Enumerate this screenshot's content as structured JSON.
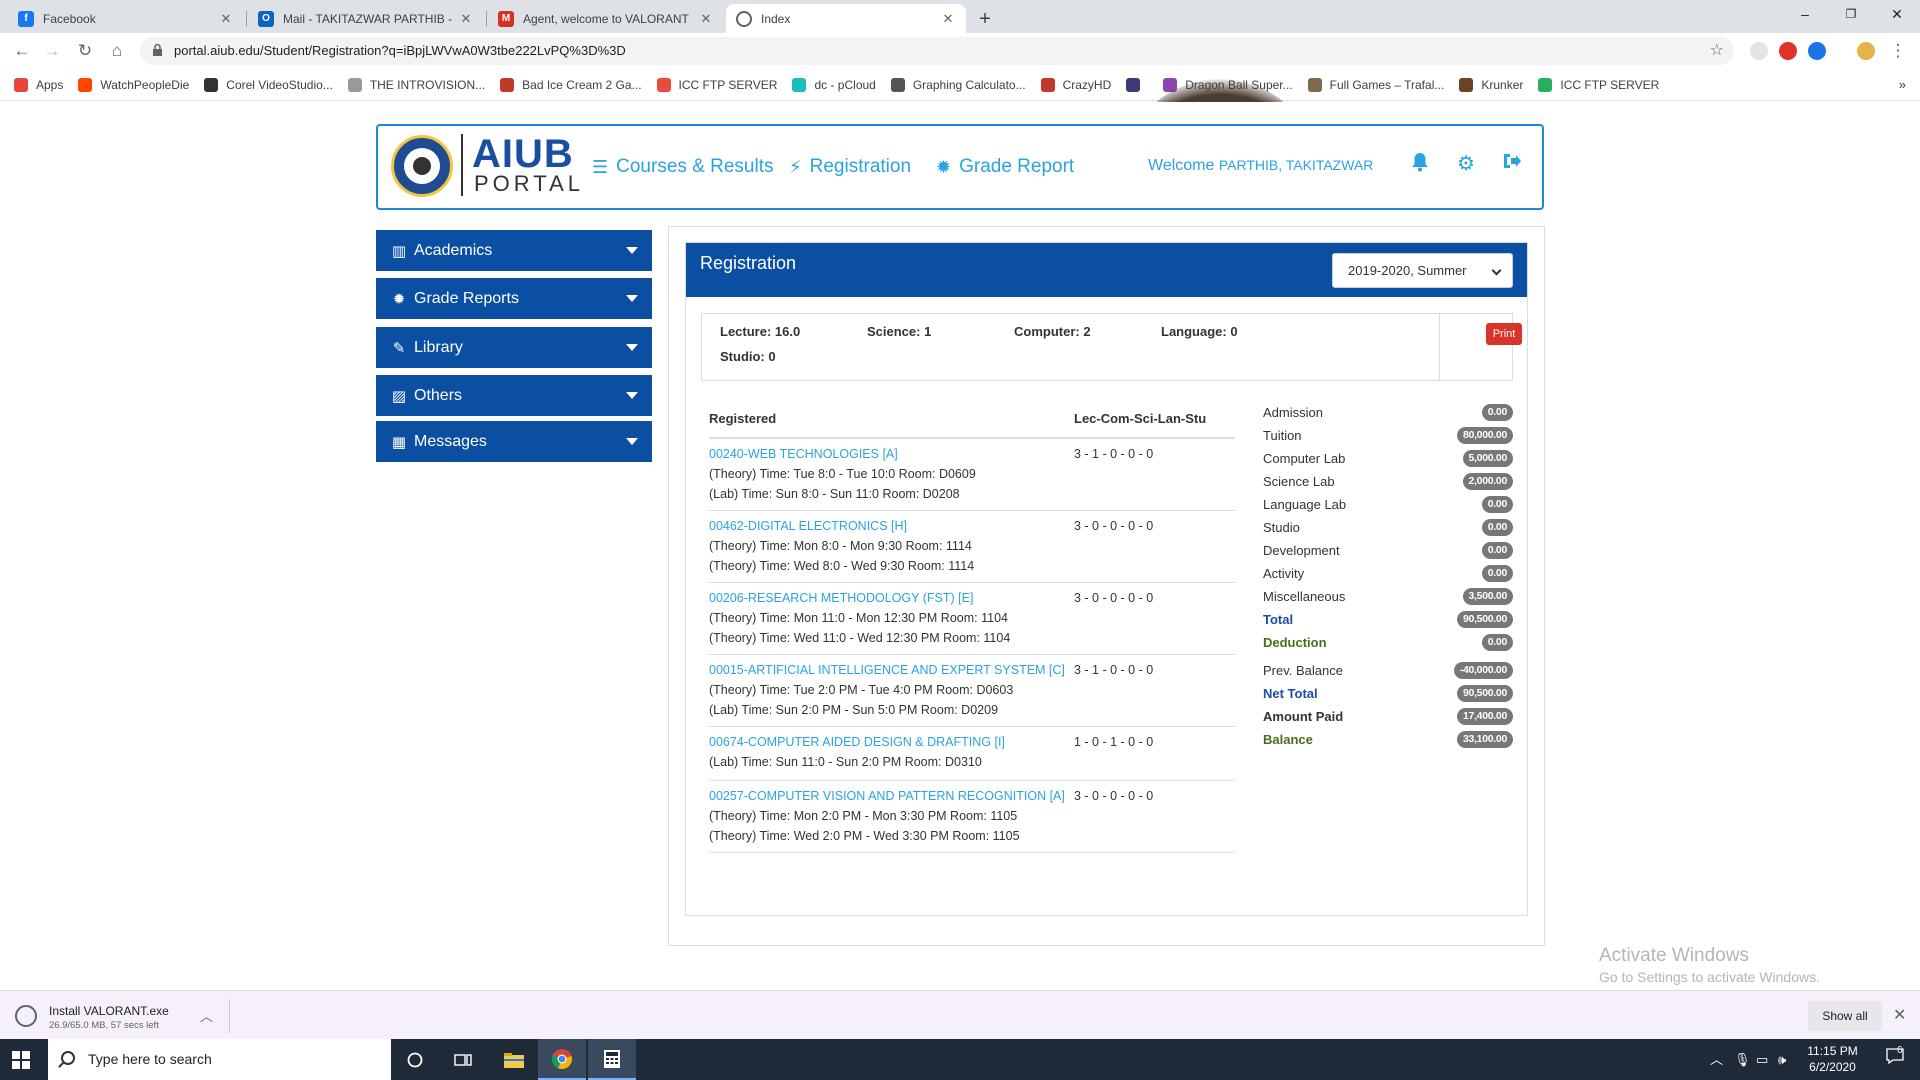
{
  "browser": {
    "tabs": [
      {
        "title": "Facebook",
        "icon": "facebook-icon",
        "color": "#1877f2",
        "glyph": "f"
      },
      {
        "title": "Mail - TAKITAZWAR PARTHIB - O",
        "icon": "outlook-icon",
        "color": "#0a64c4",
        "glyph": "O"
      },
      {
        "title": "Agent, welcome to VALORANT - ",
        "icon": "gmail-icon",
        "color": "#d93025",
        "glyph": "M"
      },
      {
        "title": "Index",
        "icon": "globe-icon",
        "color": "#5f6368",
        "glyph": ""
      }
    ],
    "url": "portal.aiub.edu/Student/Registration?q=iBpjLWVwA0W3tbe222LvPQ%3D%3D",
    "window_controls": {
      "minimize": "–",
      "maximize": "❐",
      "close": "✕"
    },
    "bookmarks": [
      {
        "label": "Apps",
        "color": "#e8453c"
      },
      {
        "label": "WatchPeopleDie",
        "color": "#ff4500"
      },
      {
        "label": "Corel VideoStudio...",
        "color": "#333333"
      },
      {
        "label": "THE INTROVISION...",
        "color": "#999999"
      },
      {
        "label": "Bad Ice Cream 2 Ga...",
        "color": "#c0392b"
      },
      {
        "label": "ICC FTP SERVER",
        "color": "#e74c3c"
      },
      {
        "label": "dc - pCloud",
        "color": "#17bebb"
      },
      {
        "label": "Graphing Calculato...",
        "color": "#555555"
      },
      {
        "label": "CrazyHD",
        "color": "#c0392b"
      },
      {
        "label": "",
        "color": "#3b3b7a"
      },
      {
        "label": "Dragon Ball Super...",
        "color": "#8e44ad"
      },
      {
        "label": "Full Games – Trafal...",
        "color": "#7f6a4e"
      },
      {
        "label": "Krunker",
        "color": "#6b4226"
      },
      {
        "label": "ICC FTP SERVER",
        "color": "#27ae60"
      }
    ]
  },
  "portal": {
    "logo_text": "AIUB",
    "logo_sub": "PORTAL",
    "nav": [
      {
        "label": "Courses & Results",
        "icon": "list-icon",
        "glyph": "☰"
      },
      {
        "label": "Registration",
        "icon": "bolt-icon",
        "glyph": "⚡"
      },
      {
        "label": "Grade Report",
        "icon": "certificate-icon",
        "glyph": "✹"
      }
    ],
    "welcome_prefix": "Welcome",
    "welcome_name": "PARTHIB, TAKITAZWAR"
  },
  "sidebar": [
    {
      "label": "Academics",
      "icon": "bar-chart-icon",
      "glyph": "▥"
    },
    {
      "label": "Grade Reports",
      "icon": "certificate-icon",
      "glyph": "✹"
    },
    {
      "label": "Library",
      "icon": "edit-icon",
      "glyph": "✎"
    },
    {
      "label": "Others",
      "icon": "image-icon",
      "glyph": "▨"
    },
    {
      "label": "Messages",
      "icon": "table-icon",
      "glyph": "▦"
    }
  ],
  "registration": {
    "title": "Registration",
    "semester": "2019-2020, Summer",
    "credits": {
      "lecture": "Lecture: 16.0",
      "science": "Science: 1",
      "computer": "Computer: 2",
      "language": "Language: 0",
      "studio": "Studio: 0"
    },
    "print_label": "Print",
    "col_registered": "Registered",
    "col_credit": "Lec-Com-Sci-Lan-Stu",
    "courses": [
      {
        "name": "00240-WEB TECHNOLOGIES [A]",
        "credit": "3 - 1 - 0 - 0 - 0",
        "lines": [
          "(Theory) Time: Tue 8:0 - Tue 10:0 Room: D0609",
          "(Lab) Time: Sun 8:0 - Sun 11:0 Room: D0208"
        ]
      },
      {
        "name": "00462-DIGITAL ELECTRONICS [H]",
        "credit": "3 - 0 - 0 - 0 - 0",
        "lines": [
          "(Theory) Time: Mon 8:0 - Mon 9:30 Room: 1114",
          "(Theory) Time: Wed 8:0 - Wed 9:30 Room: 1114"
        ]
      },
      {
        "name": "00206-RESEARCH METHODOLOGY (FST) [E]",
        "credit": "3 - 0 - 0 - 0 - 0",
        "lines": [
          "(Theory) Time: Mon 11:0 - Mon 12:30 PM Room: 1104",
          "(Theory) Time: Wed 11:0 - Wed 12:30 PM Room: 1104"
        ]
      },
      {
        "name": "00015-ARTIFICIAL INTELLIGENCE AND EXPERT SYSTEM [C]",
        "credit": "3 - 1 - 0 - 0 - 0",
        "lines": [
          "(Theory) Time: Tue 2:0 PM - Tue 4:0 PM Room: D0603",
          "(Lab) Time: Sun 2:0 PM - Sun 5:0 PM Room: D0209"
        ]
      },
      {
        "name": "00674-COMPUTER AIDED DESIGN & DRAFTING [I]",
        "credit": "1 - 0 - 1 - 0 - 0",
        "lines": [
          "(Lab) Time: Sun 11:0 - Sun 2:0 PM Room: D0310"
        ]
      },
      {
        "name": "00257-COMPUTER VISION AND PATTERN RECOGNITION [A]",
        "credit": "3 - 0 - 0 - 0 - 0",
        "lines": [
          "(Theory) Time: Mon 2:0 PM - Mon 3:30 PM Room: 1105",
          "(Theory) Time: Wed 2:0 PM - Wed 3:30 PM Room: 1105"
        ]
      }
    ],
    "fees": [
      {
        "label": "Admission",
        "value": "0.00",
        "style": ""
      },
      {
        "label": "Tuition",
        "value": "80,000.00",
        "style": ""
      },
      {
        "label": "Computer Lab",
        "value": "5,000.00",
        "style": ""
      },
      {
        "label": "Science Lab",
        "value": "2,000.00",
        "style": ""
      },
      {
        "label": "Language Lab",
        "value": "0.00",
        "style": ""
      },
      {
        "label": "Studio",
        "value": "0.00",
        "style": ""
      },
      {
        "label": "Development",
        "value": "0.00",
        "style": ""
      },
      {
        "label": "Activity",
        "value": "0.00",
        "style": ""
      },
      {
        "label": "Miscellaneous",
        "value": "3,500.00",
        "style": ""
      },
      {
        "label": "Total",
        "value": "90,500.00",
        "style": "blue"
      },
      {
        "label": "Deduction",
        "value": "0.00",
        "style": "olive"
      },
      {
        "label": "Prev. Balance",
        "value": "-40,000.00",
        "style": ""
      },
      {
        "label": "Net Total",
        "value": "90,500.00",
        "style": "blue"
      },
      {
        "label": "Amount Paid",
        "value": "17,400.00",
        "style": "b"
      },
      {
        "label": "Balance",
        "value": "33,100.00",
        "style": "olive"
      }
    ]
  },
  "watermark": {
    "line1": "Activate Windows",
    "line2": "Go to Settings to activate Windows."
  },
  "download": {
    "filename": "Install VALORANT.exe",
    "progress": "26.9/65.0 MB, 57 secs left",
    "show_all": "Show all"
  },
  "taskbar": {
    "search_placeholder": "Type here to search",
    "time": "11:15 PM",
    "date": "6/2/2020",
    "notifications": "6"
  }
}
